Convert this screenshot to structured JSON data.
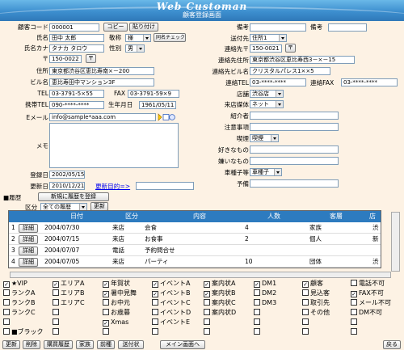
{
  "header": {
    "title": "Web Customan",
    "subtitle": "顧客登録画面"
  },
  "left": {
    "customer_code": {
      "label": "顧客コード",
      "value": "000001"
    },
    "copy_btn": "コピー",
    "paste_btn": "貼り付け",
    "name": {
      "label": "氏名",
      "value": "田中 太郎"
    },
    "honorific": {
      "label": "敬称",
      "value": "様"
    },
    "name_check_btn": "同名チェック",
    "kana": {
      "label": "氏名カナ",
      "value": "タナカ タロウ"
    },
    "gender": {
      "label": "性別",
      "value": "男"
    },
    "zip": {
      "label": "〒",
      "value": "150-0022",
      "btn": "〒"
    },
    "address": {
      "label": "住所",
      "value": "東京都渋谷区恵比寿南×－200"
    },
    "building": {
      "label": "ビル名",
      "value": "恵比寿田中マンション3F"
    },
    "tel": {
      "label": "TEL",
      "value": "03-3791-5×55"
    },
    "fax": {
      "label": "FAX",
      "value": "03-3791-59×9"
    },
    "mobile": {
      "label": "携帯TEL",
      "value": "090-****-****"
    },
    "birthday": {
      "label": "生年月日",
      "value": "1961/05/11"
    },
    "email": {
      "label": "Eメール",
      "value": "info@sample*aaa.com"
    },
    "memo": {
      "label": "メモ"
    },
    "registered": {
      "label": "登録日",
      "value": "2002/05/15"
    },
    "updated": {
      "label": "更新日",
      "value": "2010/12/21"
    },
    "update_purpose_link": "更新目的=>"
  },
  "right": {
    "notes": {
      "label": "備考",
      "label2": "備考"
    },
    "ship_to": {
      "label": "送付先",
      "value": "住所1"
    },
    "contact_zip": {
      "label": "連絡先〒",
      "value": "150-0021"
    },
    "contact_address": {
      "label": "連絡先住所",
      "value": "東京都渋谷区恵比寿西3－×－15"
    },
    "contact_building": {
      "label": "連絡先ビル名",
      "value": "クリスタルパレス1××5"
    },
    "contact_tel": {
      "label": "連絡TEL",
      "value": "03-****-****"
    },
    "contact_fax": {
      "label": "連絡FAX",
      "value": "03-****-****"
    },
    "store": {
      "label": "店舗",
      "value": "渋谷店"
    },
    "visit_media": {
      "label": "来店媒体",
      "value": "ネット"
    },
    "referrer": {
      "label": "紹介者"
    },
    "caution": {
      "label": "注意事項"
    },
    "smoking": {
      "label": "喫煙",
      "value": "喫煙"
    },
    "likes": {
      "label": "好きなもの"
    },
    "dislikes": {
      "label": "嫌いなもの"
    },
    "car_type": {
      "label": "車種子等",
      "value": "車種子"
    },
    "spare": {
      "label": "予備"
    }
  },
  "history": {
    "section_label": "■履歴",
    "register_btn": "新規に履歴を登録",
    "filter_label": "区分",
    "filter_value": "全ての履歴",
    "refresh_btn": "更新",
    "columns": [
      "日付",
      "区分",
      "内容",
      "人数",
      "客層",
      "店"
    ],
    "detail_btn": "詳細",
    "rows": [
      {
        "no": "1",
        "date": "2004/07/30",
        "type": "来店",
        "content": "会食",
        "people": "4",
        "segment": "家族",
        "store": "渋"
      },
      {
        "no": "2",
        "date": "2004/07/15",
        "type": "来店",
        "content": "お食事",
        "people": "2",
        "segment": "個人",
        "store": "新"
      },
      {
        "no": "3",
        "date": "2004/07/07",
        "type": "電話",
        "content": "予約問合せ",
        "people": "",
        "segment": "",
        "store": ""
      },
      {
        "no": "4",
        "date": "2004/07/05",
        "type": "来店",
        "content": "パーティ",
        "people": "10",
        "segment": "団体",
        "store": "渋"
      }
    ]
  },
  "checkboxes": [
    [
      {
        "label": "★VIP",
        "checked": true
      },
      {
        "label": "エリアA",
        "checked": true
      },
      {
        "label": "年賀状",
        "checked": true
      },
      {
        "label": "イベントA",
        "checked": true
      },
      {
        "label": "案内状A",
        "checked": true
      },
      {
        "label": "DM1",
        "checked": true
      },
      {
        "label": "顧客",
        "checked": true
      },
      {
        "label": "電話不可",
        "checked": false
      }
    ],
    [
      {
        "label": "ランクA",
        "checked": false
      },
      {
        "label": "エリアB",
        "checked": false
      },
      {
        "label": "暑中見舞",
        "checked": true
      },
      {
        "label": "イベントB",
        "checked": true
      },
      {
        "label": "案内状B",
        "checked": true
      },
      {
        "label": "DM2",
        "checked": false
      },
      {
        "label": "見込客",
        "checked": false
      },
      {
        "label": "FAX不可",
        "checked": true
      }
    ],
    [
      {
        "label": "ランクB",
        "checked": false
      },
      {
        "label": "エリアC",
        "checked": false
      },
      {
        "label": "お中元",
        "checked": false
      },
      {
        "label": "イベントC",
        "checked": false
      },
      {
        "label": "案内状C",
        "checked": false
      },
      {
        "label": "DM3",
        "checked": false
      },
      {
        "label": "取引先",
        "checked": false
      },
      {
        "label": "メール不可",
        "checked": false
      }
    ],
    [
      {
        "label": "ランクC",
        "checked": false
      },
      {
        "label": "",
        "checked": false
      },
      {
        "label": "お歳暮",
        "checked": false
      },
      {
        "label": "イベントD",
        "checked": false
      },
      {
        "label": "案内状D",
        "checked": false
      },
      {
        "label": "",
        "checked": false
      },
      {
        "label": "その他",
        "checked": false
      },
      {
        "label": "DM不可",
        "checked": false
      }
    ],
    [
      {
        "label": "",
        "checked": false
      },
      {
        "label": "",
        "checked": false
      },
      {
        "label": "Xmas",
        "checked": true
      },
      {
        "label": "イベントE",
        "checked": false
      },
      {
        "label": "",
        "checked": false
      },
      {
        "label": "",
        "checked": false
      },
      {
        "label": "",
        "checked": false
      },
      {
        "label": "",
        "checked": false
      }
    ],
    [
      {
        "label": "■ブラック",
        "checked": false
      },
      {
        "label": "",
        "checked": false
      },
      {
        "label": "",
        "checked": false
      },
      {
        "label": "",
        "checked": false
      },
      {
        "label": "",
        "checked": false
      },
      {
        "label": "",
        "checked": false
      },
      {
        "label": "",
        "checked": false
      },
      {
        "label": "",
        "checked": false
      }
    ]
  ],
  "bottom_bar": {
    "update": "更新",
    "delete": "削除",
    "purchase_history": "購買履歴",
    "family": "家族",
    "prev": "前種",
    "send_to": "送付状",
    "main_menu": "メイン画面へ",
    "back": "戻る"
  }
}
